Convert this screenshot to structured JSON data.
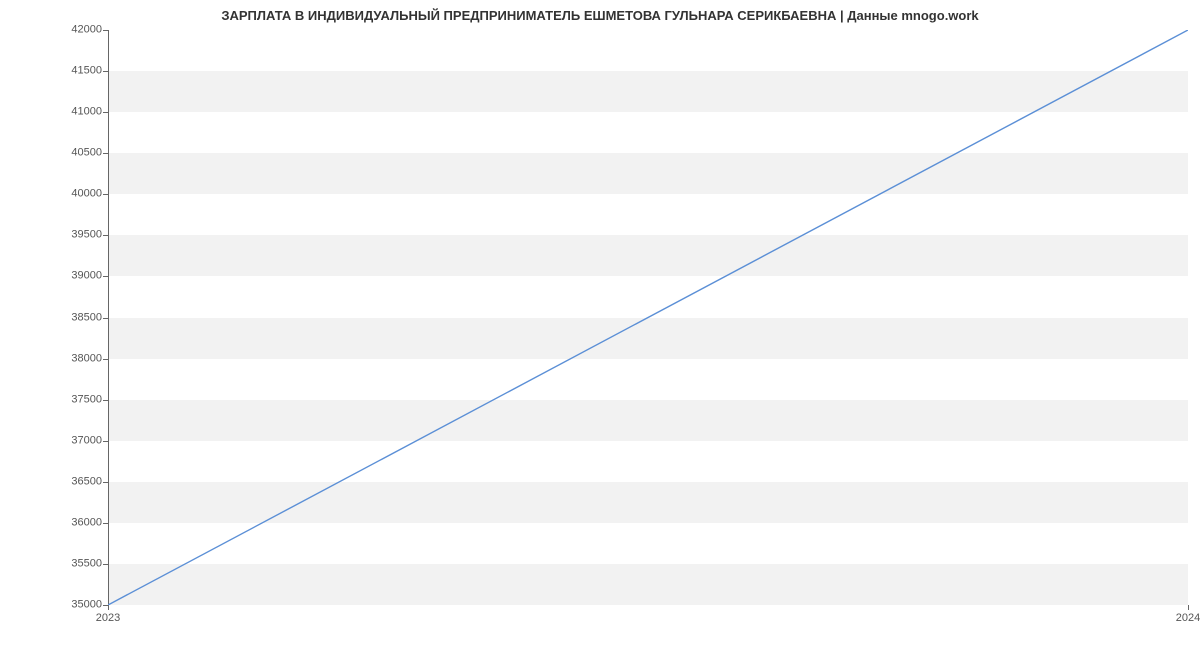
{
  "chart_data": {
    "type": "line",
    "title": "ЗАРПЛАТА В ИНДИВИДУАЛЬНЫЙ ПРЕДПРИНИМАТЕЛЬ ЕШМЕТОВА ГУЛЬНАРА СЕРИКБАЕВНА | Данные mnogo.work",
    "x": [
      2023,
      2024
    ],
    "values": [
      35000,
      42000
    ],
    "xlabel": "",
    "ylabel": "",
    "ylim": [
      35000,
      42000
    ],
    "xlim": [
      2023,
      2024
    ],
    "y_ticks": [
      35000,
      35500,
      36000,
      36500,
      37000,
      37500,
      38000,
      38500,
      39000,
      39500,
      40000,
      40500,
      41000,
      41500,
      42000
    ],
    "x_ticks": [
      2023,
      2024
    ],
    "line_color": "#5b8fd6"
  }
}
